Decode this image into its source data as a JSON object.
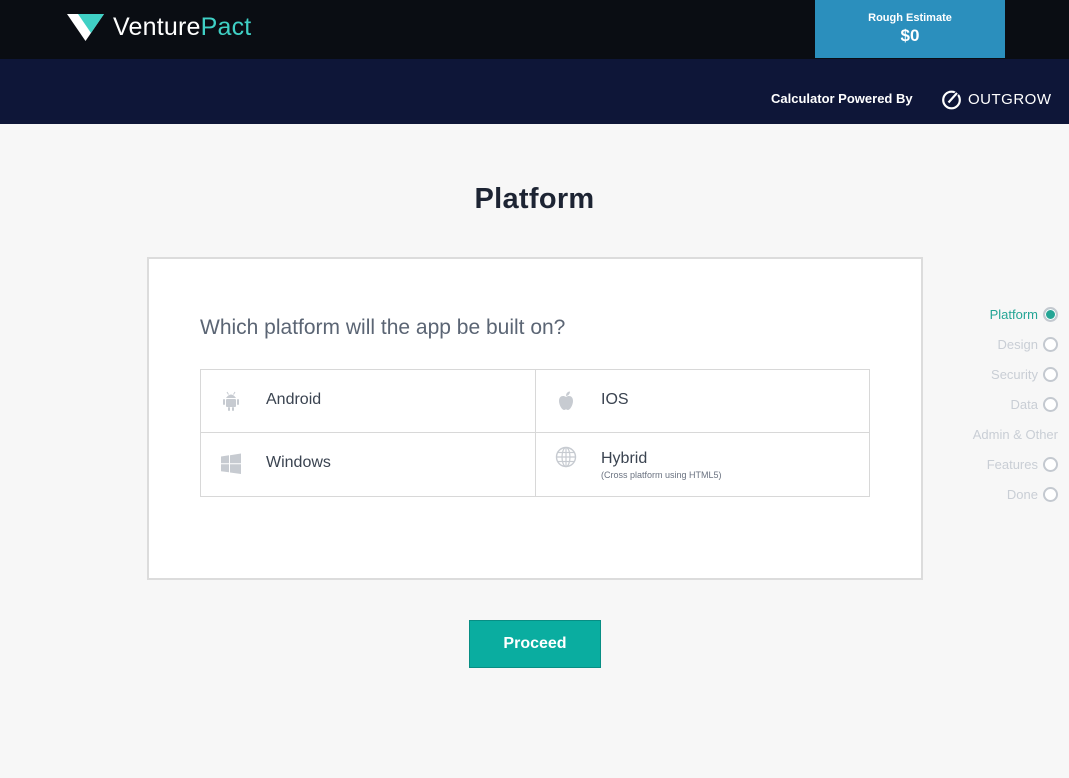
{
  "header": {
    "brand": {
      "name_part1": "Venture",
      "name_part2": "Pact"
    },
    "estimate": {
      "label": "Rough Estimate",
      "value": "$0"
    },
    "powered_by": "Calculator Powered By",
    "partner": "OUTGROW"
  },
  "page": {
    "title": "Platform",
    "question": "Which platform will the app be built on?",
    "options": [
      {
        "label": "Android",
        "icon": "android-icon"
      },
      {
        "label": "IOS",
        "icon": "apple-icon"
      },
      {
        "label": "Windows",
        "icon": "windows-icon"
      },
      {
        "label": "Hybrid",
        "sublabel": "(Cross platform using HTML5)",
        "icon": "globe-icon"
      }
    ],
    "proceed_label": "Proceed"
  },
  "steps": [
    {
      "label": "Platform",
      "active": true
    },
    {
      "label": "Design",
      "active": false
    },
    {
      "label": "Security",
      "active": false
    },
    {
      "label": "Data",
      "active": false
    },
    {
      "label": "Admin & Other",
      "active": false
    },
    {
      "label": "Features",
      "active": false
    },
    {
      "label": "Done",
      "active": false
    }
  ],
  "colors": {
    "accent": "#0aada0",
    "estimate_bg": "#2b8fbd",
    "topbar": "#0a0d13",
    "subbar": "#0e1638",
    "active_step": "#24a595"
  }
}
